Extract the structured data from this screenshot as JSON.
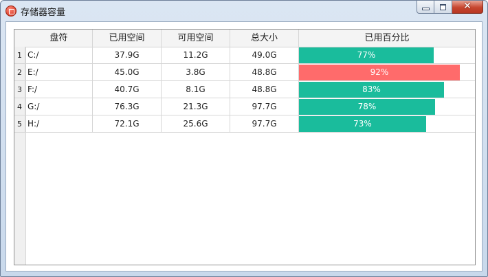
{
  "window": {
    "title": "存储器容量",
    "close_glyph": "✕"
  },
  "table": {
    "columns": [
      "盘符",
      "已用空间",
      "可用空间",
      "总大小",
      "已用百分比"
    ],
    "rows": [
      {
        "num": "1",
        "drive": "C:/",
        "used": "37.9G",
        "free": "11.2G",
        "total": "49.0G",
        "percent_label": "77%",
        "percent": 77,
        "bar_color": "#1abc9c"
      },
      {
        "num": "2",
        "drive": "E:/",
        "used": "45.0G",
        "free": "3.8G",
        "total": "48.8G",
        "percent_label": "92%",
        "percent": 92,
        "bar_color": "#ff6b6b"
      },
      {
        "num": "3",
        "drive": "F:/",
        "used": "40.7G",
        "free": "8.1G",
        "total": "48.8G",
        "percent_label": "83%",
        "percent": 83,
        "bar_color": "#1abc9c"
      },
      {
        "num": "4",
        "drive": "G:/",
        "used": "76.3G",
        "free": "21.3G",
        "total": "97.7G",
        "percent_label": "78%",
        "percent": 78,
        "bar_color": "#1abc9c"
      },
      {
        "num": "5",
        "drive": "H:/",
        "used": "72.1G",
        "free": "25.6G",
        "total": "97.7G",
        "percent_label": "73%",
        "percent": 73,
        "bar_color": "#1abc9c"
      }
    ]
  }
}
